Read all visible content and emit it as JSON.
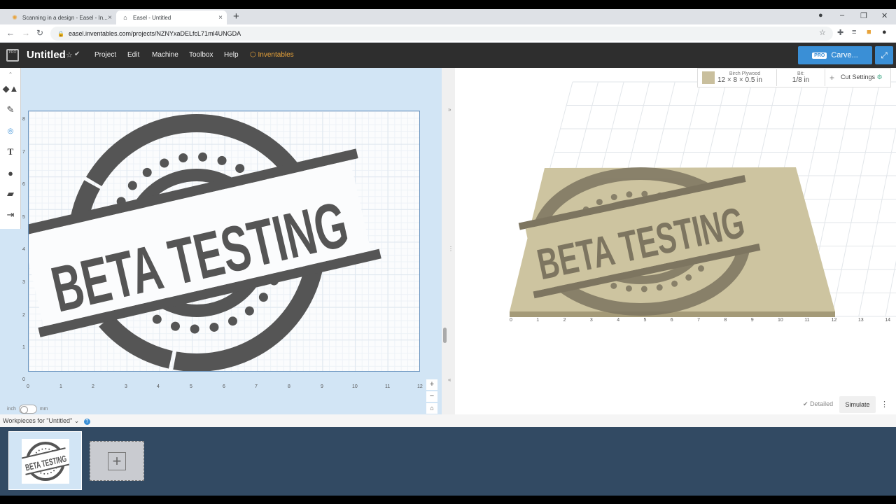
{
  "browser": {
    "tabs": [
      {
        "title": "Scanning in a design - Easel - In...",
        "icon": "easel-icon"
      },
      {
        "title": "Easel - Untitled",
        "icon": "easel-icon"
      }
    ],
    "url": "easel.inventables.com/projects/NZNYxaDELfcL71ml4UNGDA"
  },
  "app": {
    "title": "Untitled",
    "menu": [
      "Project",
      "Edit",
      "Machine",
      "Toolbox",
      "Help"
    ],
    "inventables": "Inventables",
    "carve_pro": "PRO",
    "carve_label": "Carve...",
    "logo_text": "PRO"
  },
  "canvas": {
    "y_ticks": [
      "8",
      "7",
      "6",
      "5",
      "4",
      "3",
      "2",
      "1",
      "0"
    ],
    "x_ticks": [
      "0",
      "1",
      "2",
      "3",
      "4",
      "5",
      "6",
      "7",
      "8",
      "9",
      "10",
      "11",
      "12"
    ],
    "stamp_text": "BETA TESTING",
    "unit_left": "inch",
    "unit_right": "mm"
  },
  "material": {
    "name": "Birch Plywood",
    "size": "12 × 8 × 0.5 in",
    "bit_label": "Bit:",
    "bit_value": "1/8 in",
    "cut_settings": "Cut Settings",
    "color": "#c9bf9d"
  },
  "preview": {
    "x_ticks": [
      "0",
      "1",
      "2",
      "3",
      "4",
      "5",
      "6",
      "7",
      "8",
      "9",
      "10",
      "11",
      "12",
      "13",
      "14"
    ],
    "detailed": "Detailed",
    "simulate": "Simulate"
  },
  "workpieces": {
    "label": "Workpieces for \"Untitled\""
  }
}
